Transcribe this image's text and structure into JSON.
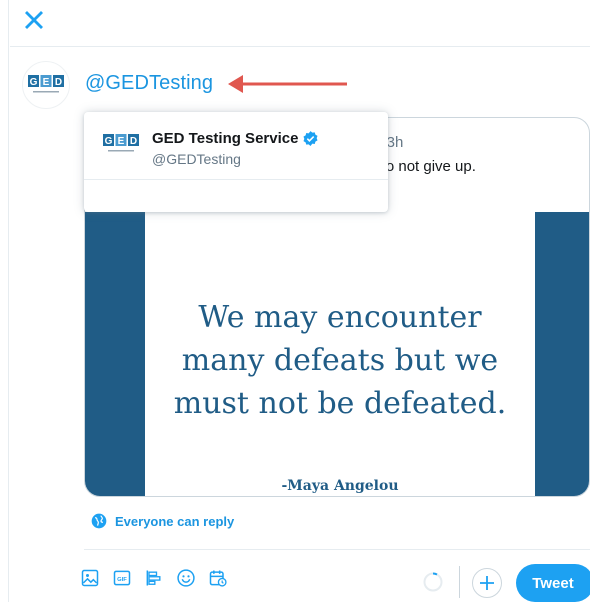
{
  "header": {
    "close_icon": "close-icon"
  },
  "composer": {
    "text": "@GEDTesting",
    "avatar": {
      "logo_letters": "GED",
      "logo_tagline": "TESTING SERVICE"
    }
  },
  "mention_dropdown": {
    "items": [
      {
        "name": "GED Testing Service",
        "handle": "@GEDTesting",
        "verified": true
      }
    ]
  },
  "quoted_tweet": {
    "meta_partial": "g · 3h",
    "text_partial": "nt to not give up.",
    "image": {
      "quote_lines": [
        "We may encounter",
        "many defeats but we",
        "must not be defeated."
      ],
      "author": "-Maya Angelou"
    }
  },
  "reply_setting": {
    "label": "Everyone can reply"
  },
  "toolbar": {
    "icons": [
      "image-icon",
      "gif-icon",
      "poll-icon",
      "emoji-icon",
      "schedule-icon"
    ],
    "tweet_label": "Tweet"
  },
  "colors": {
    "brand_blue": "#1da1f2",
    "link_blue": "#1b95e0",
    "quote_navy": "#205c86",
    "arrow_red": "#e0574f"
  }
}
